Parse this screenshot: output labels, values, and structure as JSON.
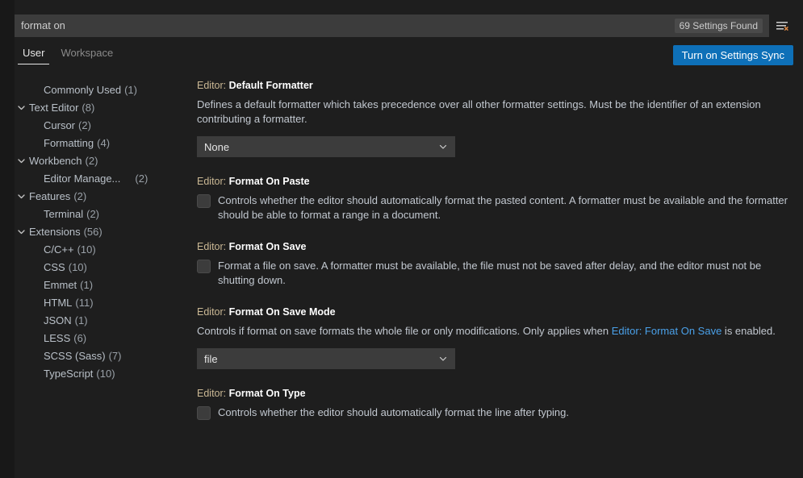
{
  "search": {
    "value": "format on",
    "placeholder": "Search settings",
    "results_badge": "69 Settings Found",
    "clear_filter_icon": "clear-filter-icon"
  },
  "tabs": [
    {
      "label": "User",
      "active": true
    },
    {
      "label": "Workspace",
      "active": false
    }
  ],
  "sync_button": {
    "label": "Turn on Settings Sync",
    "color": "#0e70b8"
  },
  "toc": [
    {
      "label": "Commonly Used",
      "count": "(1)",
      "level": "leaf",
      "expandable": false
    },
    {
      "label": "Text Editor",
      "count": "(8)",
      "level": "root",
      "expandable": true
    },
    {
      "label": "Cursor",
      "count": "(2)",
      "level": "child",
      "expandable": false
    },
    {
      "label": "Formatting",
      "count": "(4)",
      "level": "child",
      "expandable": false
    },
    {
      "label": "Workbench",
      "count": "(2)",
      "level": "root",
      "expandable": true
    },
    {
      "label": "Editor Manage...",
      "count": "(2)",
      "level": "child",
      "expandable": false,
      "gapped": true
    },
    {
      "label": "Features",
      "count": "(2)",
      "level": "root",
      "expandable": true
    },
    {
      "label": "Terminal",
      "count": "(2)",
      "level": "child",
      "expandable": false
    },
    {
      "label": "Extensions",
      "count": "(56)",
      "level": "root",
      "expandable": true
    },
    {
      "label": "C/C++",
      "count": "(10)",
      "level": "child",
      "expandable": false
    },
    {
      "label": "CSS",
      "count": "(10)",
      "level": "child",
      "expandable": false
    },
    {
      "label": "Emmet",
      "count": "(1)",
      "level": "child",
      "expandable": false
    },
    {
      "label": "HTML",
      "count": "(11)",
      "level": "child",
      "expandable": false
    },
    {
      "label": "JSON",
      "count": "(1)",
      "level": "child",
      "expandable": false
    },
    {
      "label": "LESS",
      "count": "(6)",
      "level": "child",
      "expandable": false
    },
    {
      "label": "SCSS (Sass)",
      "count": "(7)",
      "level": "child",
      "expandable": false
    },
    {
      "label": "TypeScript",
      "count": "(10)",
      "level": "child",
      "expandable": false
    }
  ],
  "settings": [
    {
      "prefix": "Editor: ",
      "name": "Default Formatter",
      "description": "Defines a default formatter which takes precedence over all other formatter settings. Must be the identifier of an extension contributing a formatter.",
      "control": "dropdown",
      "value": "None"
    },
    {
      "prefix": "Editor: ",
      "name": "Format On Paste",
      "description": "Controls whether the editor should automatically format the pasted content. A formatter must be available and the formatter should be able to format a range in a document.",
      "control": "checkbox",
      "checked": false
    },
    {
      "prefix": "Editor: ",
      "name": "Format On Save",
      "description": "Format a file on save. A formatter must be available, the file must not be saved after delay, and the editor must not be shutting down.",
      "control": "checkbox",
      "checked": false
    },
    {
      "prefix": "Editor: ",
      "name": "Format On Save Mode",
      "description_before": "Controls if format on save formats the whole file or only modifications. Only applies when ",
      "description_link": "Editor: Format On Save",
      "description_after": " is enabled.",
      "control": "dropdown",
      "value": "file"
    },
    {
      "prefix": "Editor: ",
      "name": "Format On Type",
      "description": "Controls whether the editor should automatically format the line after typing.",
      "control": "checkbox",
      "checked": false
    }
  ]
}
